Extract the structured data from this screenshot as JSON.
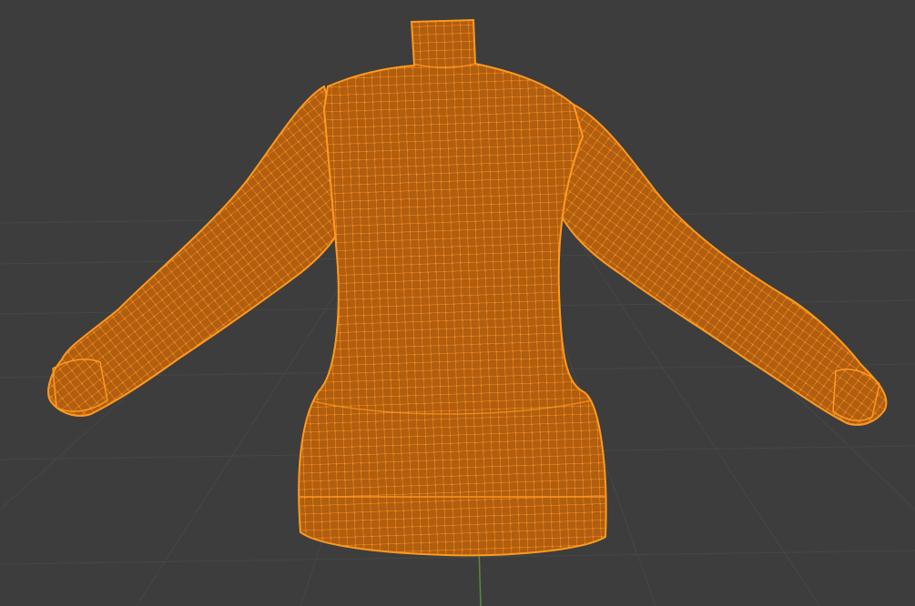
{
  "viewport": {
    "mode": "edit-mode-wireframe",
    "background_color": "#3d3d3d",
    "grid_color": "#4a4a4a",
    "axis_y_color": "#5a8a3a",
    "mesh_fill_color": "#c46a12",
    "mesh_wire_color": "#f08a1c",
    "mesh_vertex_color": "#ff9a20",
    "object": {
      "name_icon": "mesh-object-icon",
      "shape": "long-sleeve-turtleneck-sweater",
      "selected": true
    },
    "grid_visible": true
  }
}
